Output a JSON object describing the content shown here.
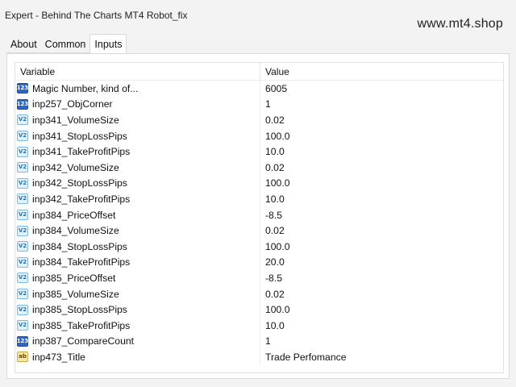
{
  "window": {
    "title": "Expert - Behind The Charts MT4 Robot_fix",
    "watermark": "www.mt4.shop"
  },
  "tabs": [
    {
      "label": "About",
      "active": false
    },
    {
      "label": "Common",
      "active": false
    },
    {
      "label": "Inputs",
      "active": true
    }
  ],
  "table": {
    "columns": [
      "Variable",
      "Value"
    ],
    "rows": [
      {
        "icon": "int",
        "icon_text": "123",
        "variable": "Magic Number, kind of...",
        "value": "6005"
      },
      {
        "icon": "int",
        "icon_text": "123",
        "variable": "inp257_ObjCorner",
        "value": "1"
      },
      {
        "icon": "dbl",
        "icon_text": "V2",
        "variable": "inp341_VolumeSize",
        "value": "0.02"
      },
      {
        "icon": "dbl",
        "icon_text": "V2",
        "variable": "inp341_StopLossPips",
        "value": "100.0"
      },
      {
        "icon": "dbl",
        "icon_text": "V2",
        "variable": "inp341_TakeProfitPips",
        "value": "10.0"
      },
      {
        "icon": "dbl",
        "icon_text": "V2",
        "variable": "inp342_VolumeSize",
        "value": "0.02"
      },
      {
        "icon": "dbl",
        "icon_text": "V2",
        "variable": "inp342_StopLossPips",
        "value": "100.0"
      },
      {
        "icon": "dbl",
        "icon_text": "V2",
        "variable": "inp342_TakeProfitPips",
        "value": "10.0"
      },
      {
        "icon": "dbl",
        "icon_text": "V2",
        "variable": "inp384_PriceOffset",
        "value": "-8.5"
      },
      {
        "icon": "dbl",
        "icon_text": "V2",
        "variable": "inp384_VolumeSize",
        "value": "0.02"
      },
      {
        "icon": "dbl",
        "icon_text": "V2",
        "variable": "inp384_StopLossPips",
        "value": "100.0"
      },
      {
        "icon": "dbl",
        "icon_text": "V2",
        "variable": "inp384_TakeProfitPips",
        "value": "20.0"
      },
      {
        "icon": "dbl",
        "icon_text": "V2",
        "variable": "inp385_PriceOffset",
        "value": "-8.5"
      },
      {
        "icon": "dbl",
        "icon_text": "V2",
        "variable": "inp385_VolumeSize",
        "value": "0.02"
      },
      {
        "icon": "dbl",
        "icon_text": "V2",
        "variable": "inp385_StopLossPips",
        "value": "100.0"
      },
      {
        "icon": "dbl",
        "icon_text": "V2",
        "variable": "inp385_TakeProfitPips",
        "value": "10.0"
      },
      {
        "icon": "int",
        "icon_text": "123",
        "variable": "inp387_CompareCount",
        "value": "1"
      },
      {
        "icon": "str",
        "icon_text": "ab",
        "variable": "inp473_Title",
        "value": "Trade Perfomance"
      }
    ]
  },
  "colors": {
    "int_icon": "#2b66c9",
    "double_icon": "#dff1fb",
    "string_icon": "#f6e7a7"
  }
}
